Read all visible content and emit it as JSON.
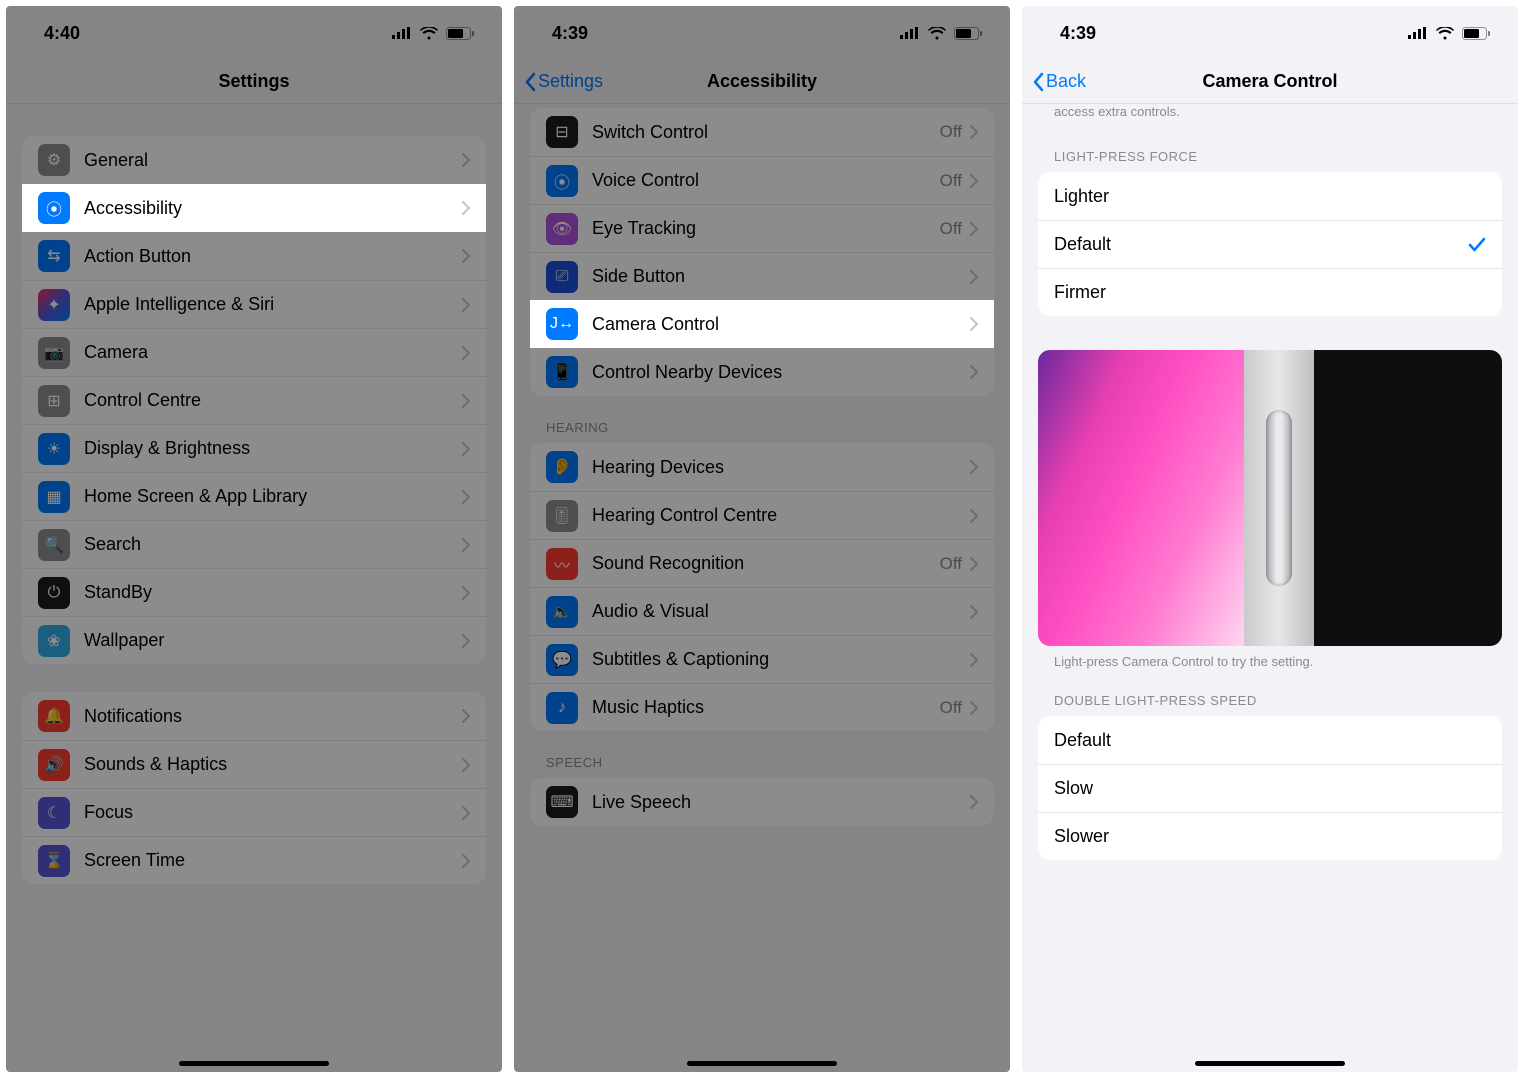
{
  "phone1": {
    "time": "4:40",
    "nav_title": "Settings",
    "rows": [
      {
        "label": "General",
        "icon": "gear-icon",
        "cls": "ic-gray"
      },
      {
        "label": "Accessibility",
        "icon": "accessibility-icon",
        "cls": "ic-blue",
        "highlight": true
      },
      {
        "label": "Action Button",
        "icon": "action-button-icon",
        "cls": "ic-blue"
      },
      {
        "label": "Apple Intelligence & Siri",
        "icon": "siri-icon",
        "cls": "ic-rainbow"
      },
      {
        "label": "Camera",
        "icon": "camera-icon",
        "cls": "ic-gray"
      },
      {
        "label": "Control Centre",
        "icon": "control-centre-icon",
        "cls": "ic-gray"
      },
      {
        "label": "Display & Brightness",
        "icon": "brightness-icon",
        "cls": "ic-blue"
      },
      {
        "label": "Home Screen & App Library",
        "icon": "home-screen-icon",
        "cls": "ic-blue"
      },
      {
        "label": "Search",
        "icon": "search-icon",
        "cls": "ic-gray"
      },
      {
        "label": "StandBy",
        "icon": "standby-icon",
        "cls": "ic-black"
      },
      {
        "label": "Wallpaper",
        "icon": "wallpaper-icon",
        "cls": "ic-teal"
      }
    ],
    "rows2": [
      {
        "label": "Notifications",
        "icon": "notifications-icon",
        "cls": "ic-red"
      },
      {
        "label": "Sounds & Haptics",
        "icon": "sounds-icon",
        "cls": "ic-red"
      },
      {
        "label": "Focus",
        "icon": "focus-icon",
        "cls": "ic-indigo"
      },
      {
        "label": "Screen Time",
        "icon": "screen-time-icon",
        "cls": "ic-indigo"
      }
    ]
  },
  "phone2": {
    "time": "4:39",
    "back": "Settings",
    "nav_title": "Accessibility",
    "rows": [
      {
        "label": "Switch Control",
        "value": "Off",
        "icon": "switch-control-icon",
        "cls": "ic-black"
      },
      {
        "label": "Voice Control",
        "value": "Off",
        "icon": "voice-control-icon",
        "cls": "ic-blue"
      },
      {
        "label": "Eye Tracking",
        "value": "Off",
        "icon": "eye-tracking-icon",
        "cls": "ic-purple"
      },
      {
        "label": "Side Button",
        "icon": "side-button-icon",
        "cls": "ic-darkblue"
      },
      {
        "label": "Camera Control",
        "icon": "camera-control-icon",
        "cls": "ic-blue",
        "highlight": true
      },
      {
        "label": "Control Nearby Devices",
        "icon": "nearby-devices-icon",
        "cls": "ic-blue"
      }
    ],
    "hearing_header": "HEARING",
    "hearing_rows": [
      {
        "label": "Hearing Devices",
        "icon": "hearing-devices-icon",
        "cls": "ic-blue"
      },
      {
        "label": "Hearing Control Centre",
        "icon": "hearing-control-icon",
        "cls": "ic-gray"
      },
      {
        "label": "Sound Recognition",
        "value": "Off",
        "icon": "sound-recognition-icon",
        "cls": "ic-red"
      },
      {
        "label": "Audio & Visual",
        "icon": "audio-visual-icon",
        "cls": "ic-blue"
      },
      {
        "label": "Subtitles & Captioning",
        "icon": "subtitles-icon",
        "cls": "ic-blue"
      },
      {
        "label": "Music Haptics",
        "value": "Off",
        "icon": "music-haptics-icon",
        "cls": "ic-blue"
      }
    ],
    "speech_header": "SPEECH",
    "speech_rows": [
      {
        "label": "Live Speech",
        "icon": "live-speech-icon",
        "cls": "ic-black"
      }
    ]
  },
  "phone3": {
    "time": "4:39",
    "back": "Back",
    "nav_title": "Camera Control",
    "top_footer": "access extra controls.",
    "force_header": "LIGHT-PRESS FORCE",
    "force_rows": [
      {
        "label": "Lighter"
      },
      {
        "label": "Default",
        "checked": true
      },
      {
        "label": "Firmer"
      }
    ],
    "preview_footer": "Light-press Camera Control to try the setting.",
    "speed_header": "DOUBLE LIGHT-PRESS SPEED",
    "speed_rows": [
      {
        "label": "Default"
      },
      {
        "label": "Slow"
      },
      {
        "label": "Slower"
      }
    ]
  }
}
